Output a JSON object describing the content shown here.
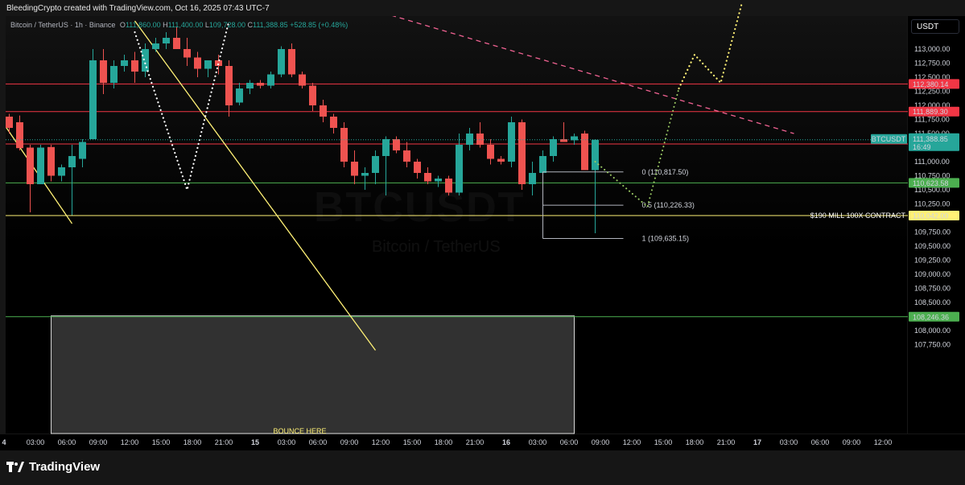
{
  "header": {
    "attribution": "BleedingCrypto created with TradingView.com, Oct 16, 2025 07:43 UTC-7"
  },
  "legend": {
    "symbol": "Bitcoin / TetherUS · 1h · Binance",
    "open_label": "O",
    "open": "111,860.00",
    "high_label": "H",
    "high": "111,400.00",
    "low_label": "L",
    "low": "109,728.00",
    "close_label": "C",
    "close": "111,388.85",
    "change": "+528.85 (+0.48%)"
  },
  "watermark": {
    "ticker": "BTCUSDT",
    "name": "Bitcoin / TetherUS"
  },
  "currency_button": "USDT",
  "footer": {
    "brand": "TradingView"
  },
  "colors": {
    "up": "#26a69a",
    "down": "#ef5350",
    "red_line": "#f23645",
    "green_line": "#4caf50",
    "yellow": "#fff176",
    "dashed_trend": "#f06292"
  },
  "chart_data": {
    "type": "candlestick",
    "y_axis": {
      "ticks": [
        "113,000.00",
        "112,750.00",
        "112,500.00",
        "112,250.00",
        "112,000.00",
        "111,750.00",
        "111,500.00",
        "111,000.00",
        "110,750.00",
        "110,500.00",
        "110,250.00",
        "109,750.00",
        "109,500.00",
        "109,250.00",
        "109,000.00",
        "108,750.00",
        "108,500.00",
        "108,000.00",
        "107,750.00"
      ],
      "tick_values": [
        113000,
        112750,
        112500,
        112250,
        112000,
        111750,
        111500,
        111000,
        110750,
        110500,
        110250,
        109750,
        109500,
        109250,
        109000,
        108750,
        108500,
        108000,
        107750
      ]
    },
    "x_axis": {
      "ticks": [
        {
          "label": "4",
          "hour": -2,
          "bold": true
        },
        {
          "label": "03:00",
          "hour": 1
        },
        {
          "label": "06:00",
          "hour": 4
        },
        {
          "label": "09:00",
          "hour": 7
        },
        {
          "label": "12:00",
          "hour": 10
        },
        {
          "label": "15:00",
          "hour": 13
        },
        {
          "label": "18:00",
          "hour": 16
        },
        {
          "label": "21:00",
          "hour": 19
        },
        {
          "label": "15",
          "hour": 22,
          "bold": true
        },
        {
          "label": "03:00",
          "hour": 25
        },
        {
          "label": "06:00",
          "hour": 28
        },
        {
          "label": "09:00",
          "hour": 31
        },
        {
          "label": "12:00",
          "hour": 34
        },
        {
          "label": "15:00",
          "hour": 37
        },
        {
          "label": "18:00",
          "hour": 40
        },
        {
          "label": "21:00",
          "hour": 43
        },
        {
          "label": "16",
          "hour": 46,
          "bold": true
        },
        {
          "label": "03:00",
          "hour": 49
        },
        {
          "label": "06:00",
          "hour": 52
        },
        {
          "label": "09:00",
          "hour": 55
        },
        {
          "label": "12:00",
          "hour": 58
        },
        {
          "label": "15:00",
          "hour": 61
        },
        {
          "label": "18:00",
          "hour": 64
        },
        {
          "label": "21:00",
          "hour": 67
        },
        {
          "label": "17",
          "hour": 70,
          "bold": true
        },
        {
          "label": "03:00",
          "hour": 73
        },
        {
          "label": "06:00",
          "hour": 76
        },
        {
          "label": "09:00",
          "hour": 79
        },
        {
          "label": "12:00",
          "hour": 82
        }
      ]
    },
    "candles": [
      {
        "h": -2.5,
        "o": 111880,
        "hi": 111980,
        "l": 111800,
        "c": 111800
      },
      {
        "h": -1.5,
        "o": 111800,
        "hi": 111850,
        "l": 111500,
        "c": 111600
      },
      {
        "h": -0.5,
        "o": 111700,
        "hi": 111820,
        "l": 111200,
        "c": 111240
      },
      {
        "h": 0.5,
        "o": 111250,
        "hi": 111300,
        "l": 110100,
        "c": 110600
      },
      {
        "h": 1.5,
        "o": 110600,
        "hi": 111300,
        "l": 110600,
        "c": 111250
      },
      {
        "h": 2.5,
        "o": 111260,
        "hi": 111300,
        "l": 110650,
        "c": 110750
      },
      {
        "h": 3.5,
        "o": 110750,
        "hi": 110950,
        "l": 110650,
        "c": 110900
      },
      {
        "h": 4.5,
        "o": 110900,
        "hi": 111300,
        "l": 110050,
        "c": 111100
      },
      {
        "h": 5.5,
        "o": 111050,
        "hi": 111400,
        "l": 110900,
        "c": 111350
      },
      {
        "h": 6.5,
        "o": 111400,
        "hi": 113000,
        "l": 111400,
        "c": 112800
      },
      {
        "h": 7.5,
        "o": 112800,
        "hi": 113000,
        "l": 112200,
        "c": 112400
      },
      {
        "h": 8.5,
        "o": 112400,
        "hi": 112800,
        "l": 112300,
        "c": 112700
      },
      {
        "h": 9.5,
        "o": 112700,
        "hi": 112900,
        "l": 112600,
        "c": 112800
      },
      {
        "h": 10.5,
        "o": 112800,
        "hi": 112950,
        "l": 112400,
        "c": 112600
      },
      {
        "h": 11.5,
        "o": 112600,
        "hi": 113100,
        "l": 112500,
        "c": 113000
      },
      {
        "h": 12.5,
        "o": 113000,
        "hi": 113200,
        "l": 112950,
        "c": 113100
      },
      {
        "h": 13.5,
        "o": 113100,
        "hi": 113300,
        "l": 113000,
        "c": 113200
      },
      {
        "h": 14.5,
        "o": 113200,
        "hi": 113400,
        "l": 113000,
        "c": 113000
      },
      {
        "h": 15.5,
        "o": 113000,
        "hi": 113200,
        "l": 112700,
        "c": 112850
      },
      {
        "h": 16.5,
        "o": 112850,
        "hi": 112950,
        "l": 112500,
        "c": 112650
      },
      {
        "h": 17.5,
        "o": 112650,
        "hi": 112800,
        "l": 112500,
        "c": 112800
      },
      {
        "h": 18.5,
        "o": 112800,
        "hi": 112900,
        "l": 112550,
        "c": 112700
      },
      {
        "h": 19.5,
        "o": 112700,
        "hi": 112800,
        "l": 111800,
        "c": 112000
      },
      {
        "h": 20.5,
        "o": 112050,
        "hi": 112400,
        "l": 112000,
        "c": 112300
      },
      {
        "h": 21.5,
        "o": 112300,
        "hi": 112450,
        "l": 112200,
        "c": 112400
      },
      {
        "h": 22.5,
        "o": 112400,
        "hi": 112450,
        "l": 112300,
        "c": 112350
      },
      {
        "h": 23.5,
        "o": 112350,
        "hi": 112600,
        "l": 112300,
        "c": 112550
      },
      {
        "h": 24.5,
        "o": 112550,
        "hi": 113050,
        "l": 112500,
        "c": 113000
      },
      {
        "h": 25.5,
        "o": 113000,
        "hi": 113100,
        "l": 112500,
        "c": 112550
      },
      {
        "h": 26.5,
        "o": 112550,
        "hi": 112600,
        "l": 112300,
        "c": 112350
      },
      {
        "h": 27.5,
        "o": 112350,
        "hi": 112400,
        "l": 111900,
        "c": 112000
      },
      {
        "h": 28.5,
        "o": 112000,
        "hi": 112100,
        "l": 111700,
        "c": 111800
      },
      {
        "h": 29.5,
        "o": 111800,
        "hi": 111850,
        "l": 111500,
        "c": 111600
      },
      {
        "h": 30.5,
        "o": 111600,
        "hi": 111700,
        "l": 110900,
        "c": 111000
      },
      {
        "h": 31.5,
        "o": 111000,
        "hi": 111200,
        "l": 110600,
        "c": 110750
      },
      {
        "h": 32.5,
        "o": 110750,
        "hi": 110900,
        "l": 110500,
        "c": 110800
      },
      {
        "h": 33.5,
        "o": 110800,
        "hi": 111200,
        "l": 110600,
        "c": 111100
      },
      {
        "h": 34.5,
        "o": 111100,
        "hi": 111450,
        "l": 110400,
        "c": 111400
      },
      {
        "h": 35.5,
        "o": 111400,
        "hi": 111450,
        "l": 111150,
        "c": 111200
      },
      {
        "h": 36.5,
        "o": 111200,
        "hi": 111350,
        "l": 110900,
        "c": 111000
      },
      {
        "h": 37.5,
        "o": 111000,
        "hi": 111050,
        "l": 110700,
        "c": 110800
      },
      {
        "h": 38.5,
        "o": 110800,
        "hi": 110900,
        "l": 110600,
        "c": 110650
      },
      {
        "h": 39.5,
        "o": 110650,
        "hi": 110750,
        "l": 110550,
        "c": 110700
      },
      {
        "h": 40.5,
        "o": 110700,
        "hi": 110750,
        "l": 110400,
        "c": 110450
      },
      {
        "h": 41.5,
        "o": 110450,
        "hi": 111500,
        "l": 110400,
        "c": 111300
      },
      {
        "h": 42.5,
        "o": 111300,
        "hi": 111600,
        "l": 111200,
        "c": 111500
      },
      {
        "h": 43.5,
        "o": 111500,
        "hi": 111700,
        "l": 111250,
        "c": 111300
      },
      {
        "h": 44.5,
        "o": 111300,
        "hi": 111400,
        "l": 110950,
        "c": 111050
      },
      {
        "h": 45.5,
        "o": 111050,
        "hi": 111100,
        "l": 110950,
        "c": 111000
      },
      {
        "h": 46.5,
        "o": 111000,
        "hi": 111800,
        "l": 110900,
        "c": 111700
      },
      {
        "h": 47.5,
        "o": 111700,
        "hi": 111750,
        "l": 110500,
        "c": 110600
      },
      {
        "h": 48.5,
        "o": 110600,
        "hi": 111000,
        "l": 110400,
        "c": 110800
      },
      {
        "h": 49.5,
        "o": 110800,
        "hi": 111200,
        "l": 110700,
        "c": 111100
      },
      {
        "h": 50.5,
        "o": 111100,
        "hi": 111450,
        "l": 111000,
        "c": 111400
      },
      {
        "h": 51.5,
        "o": 111400,
        "hi": 111700,
        "l": 111350,
        "c": 111350
      },
      {
        "h": 52.5,
        "o": 111380,
        "hi": 111500,
        "l": 111300,
        "c": 111450
      },
      {
        "h": 53.5,
        "o": 111500,
        "hi": 111550,
        "l": 110950,
        "c": 110850
      },
      {
        "h": 54.5,
        "o": 110850,
        "hi": 111400,
        "l": 109728,
        "c": 111388.85
      }
    ],
    "horizontal_lines": [
      {
        "value": 112380.14,
        "label": "112,380.14",
        "color": "#f23645"
      },
      {
        "value": 111889.3,
        "label": "111,889.30",
        "color": "#f23645"
      },
      {
        "value": 111313.98,
        "label": "111,313.98",
        "color": "#f23645"
      },
      {
        "value": 110623.58,
        "label": "110,623.58",
        "color": "#4caf50"
      },
      {
        "value": 110042.0,
        "label": "110,042.00",
        "color": "#fff176",
        "note": "$190 MILL 100X CONTRACT"
      },
      {
        "value": 108246.36,
        "label": "108,246.36",
        "color": "#4caf50"
      }
    ],
    "last_price": {
      "value": 111388.85,
      "ticker": "BTCUSDT",
      "price_label": "111,388.85",
      "countdown": "16:49"
    },
    "fibonacci": [
      {
        "level": "0",
        "label": "0 (110,817.50)",
        "value": 110817.5
      },
      {
        "level": "0.5",
        "label": "0.5 (110,226.33)",
        "value": 110226.33
      },
      {
        "level": "1",
        "label": "1 (109,635.15)",
        "value": 109635.15
      }
    ],
    "fib_range_hours": [
      49.5,
      54.5
    ],
    "dashed_trendline": [
      {
        "h": 35,
        "v": 113600
      },
      {
        "h": 73.5,
        "v": 111500
      }
    ],
    "yellow_trendlines": [
      [
        {
          "h": -2.5,
          "v": 111800
        },
        {
          "h": 4.5,
          "v": 109900
        }
      ],
      [
        {
          "h": 10.5,
          "v": 113500
        },
        {
          "h": 33.5,
          "v": 107650
        }
      ]
    ],
    "white_dotted_path": [
      {
        "h": 10.5,
        "v": 113300
      },
      {
        "h": 15.5,
        "v": 110500
      },
      {
        "h": 19.5,
        "v": 113500
      }
    ],
    "green_dotted_path": [
      {
        "h": 54.5,
        "v": 111000
      },
      {
        "h": 59.5,
        "v": 110200
      },
      {
        "h": 62.5,
        "v": 112300
      }
    ],
    "yellow_dotted_path": [
      {
        "h": 62.5,
        "v": 112300
      },
      {
        "h": 64,
        "v": 112900
      },
      {
        "h": 66.5,
        "v": 112400
      },
      {
        "h": 68.5,
        "v": 113800
      }
    ],
    "zone": {
      "start_hour": 2.5,
      "end_hour": 52.5,
      "top": 108246.36,
      "label": "BOUNCE HERE"
    }
  }
}
